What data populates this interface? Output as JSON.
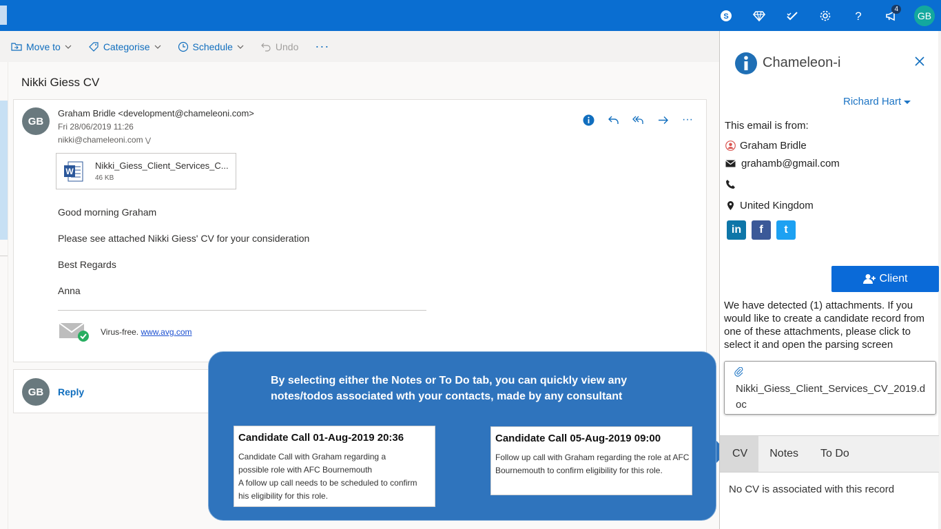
{
  "topbar": {
    "notification_count": "4",
    "user_initials": "GB",
    "icons": [
      "skype-icon",
      "diamond-icon",
      "checkmark-icon",
      "gear-icon",
      "help-icon",
      "megaphone-icon"
    ]
  },
  "toolbar": {
    "move_to": "Move to",
    "categorise": "Categorise",
    "schedule": "Schedule",
    "undo": "Undo",
    "more": "···"
  },
  "message": {
    "subject": "Nikki Giess CV",
    "avatar": "GB",
    "sender": "Graham Bridle <development@chameleoni.com>",
    "date": "Fri 28/06/2019 11:26",
    "to": "nikki@chameleoni.com",
    "attachment": {
      "name": "Nikki_Giess_Client_Services_C...",
      "size": "46 KB"
    },
    "body": [
      "Good morning Graham",
      "Please see attached Nikki Giess' CV for your consideration",
      "Best Regards",
      "Anna"
    ],
    "virus_text": "Virus-free.",
    "virus_link": "www.avg.com"
  },
  "reply": {
    "avatar": "GB",
    "label": "Reply"
  },
  "callout": {
    "text": "By selecting either the Notes or To Do tab, you can quickly view any notes/todos associated wth your contacts, made by any consultant",
    "cards": [
      {
        "title": "Candidate Call 01-Aug-2019 20:36",
        "body": "Candidate Call with Graham regarding a possible role with AFC Bournemouth\nA follow up call needs to be scheduled to confirm his eligibility for this role."
      },
      {
        "title": "Candidate Call 05-Aug-2019 09:00",
        "body": "Follow up call with Graham regarding the role at AFC Bournemouth to confirm eligibility for this role."
      }
    ]
  },
  "panel": {
    "title": "Chameleon-i",
    "user": "Richard Hart",
    "from_label": "This email is from:",
    "contact_name": "Graham Bridle",
    "email": "grahamb@gmail.com",
    "phone": "",
    "location": "United Kingdom",
    "social": [
      "in",
      "f",
      "t"
    ],
    "client_button": "Client",
    "detect_text": "We have detected (1) attachments. If you would like to create a candidate record from one of these attachments, please click to select it and open the parsing screen",
    "file_name": "Nikki_Giess_Client_Services_CV_2019.doc",
    "tabs": [
      "CV",
      "Notes",
      "To Do"
    ],
    "tab_content": "No CV is associated with this record"
  },
  "colors": {
    "topbar": "#0a6ed1",
    "accent": "#106ebe",
    "callout": "#2f74bd",
    "client_button": "#0a6ad8"
  }
}
